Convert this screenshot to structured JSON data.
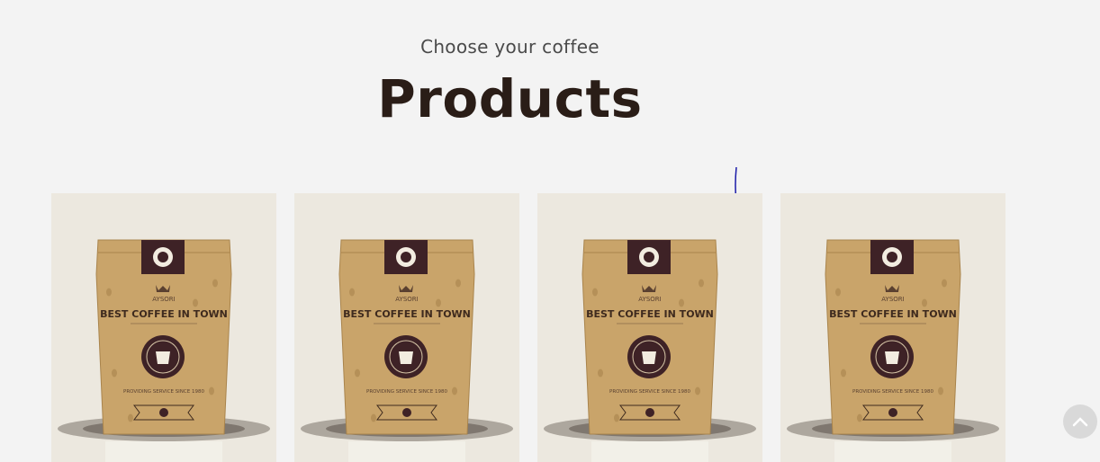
{
  "header": {
    "subtitle": "Choose your coffee",
    "title": "Products"
  },
  "products": [
    {
      "brand": "AYSORI",
      "tagline": "BEST COFFEE IN TOWN",
      "footer": "PROVIDING SERVICE SINCE 1980"
    },
    {
      "brand": "AYSORI",
      "tagline": "BEST COFFEE IN TOWN",
      "footer": "PROVIDING SERVICE SINCE 1980"
    },
    {
      "brand": "AYSORI",
      "tagline": "BEST COFFEE IN TOWN",
      "footer": "PROVIDING SERVICE SINCE 1980"
    },
    {
      "brand": "AYSORI",
      "tagline": "BEST COFFEE IN TOWN",
      "footer": "PROVIDING SERVICE SINCE 1980"
    }
  ],
  "icons": {
    "scroll_top": "chevron-up-icon"
  },
  "colors": {
    "background": "#f3f3f3",
    "card": "#ece8df",
    "title": "#2a1d17",
    "bag": "#c9a46a",
    "label": "#3e2226"
  }
}
